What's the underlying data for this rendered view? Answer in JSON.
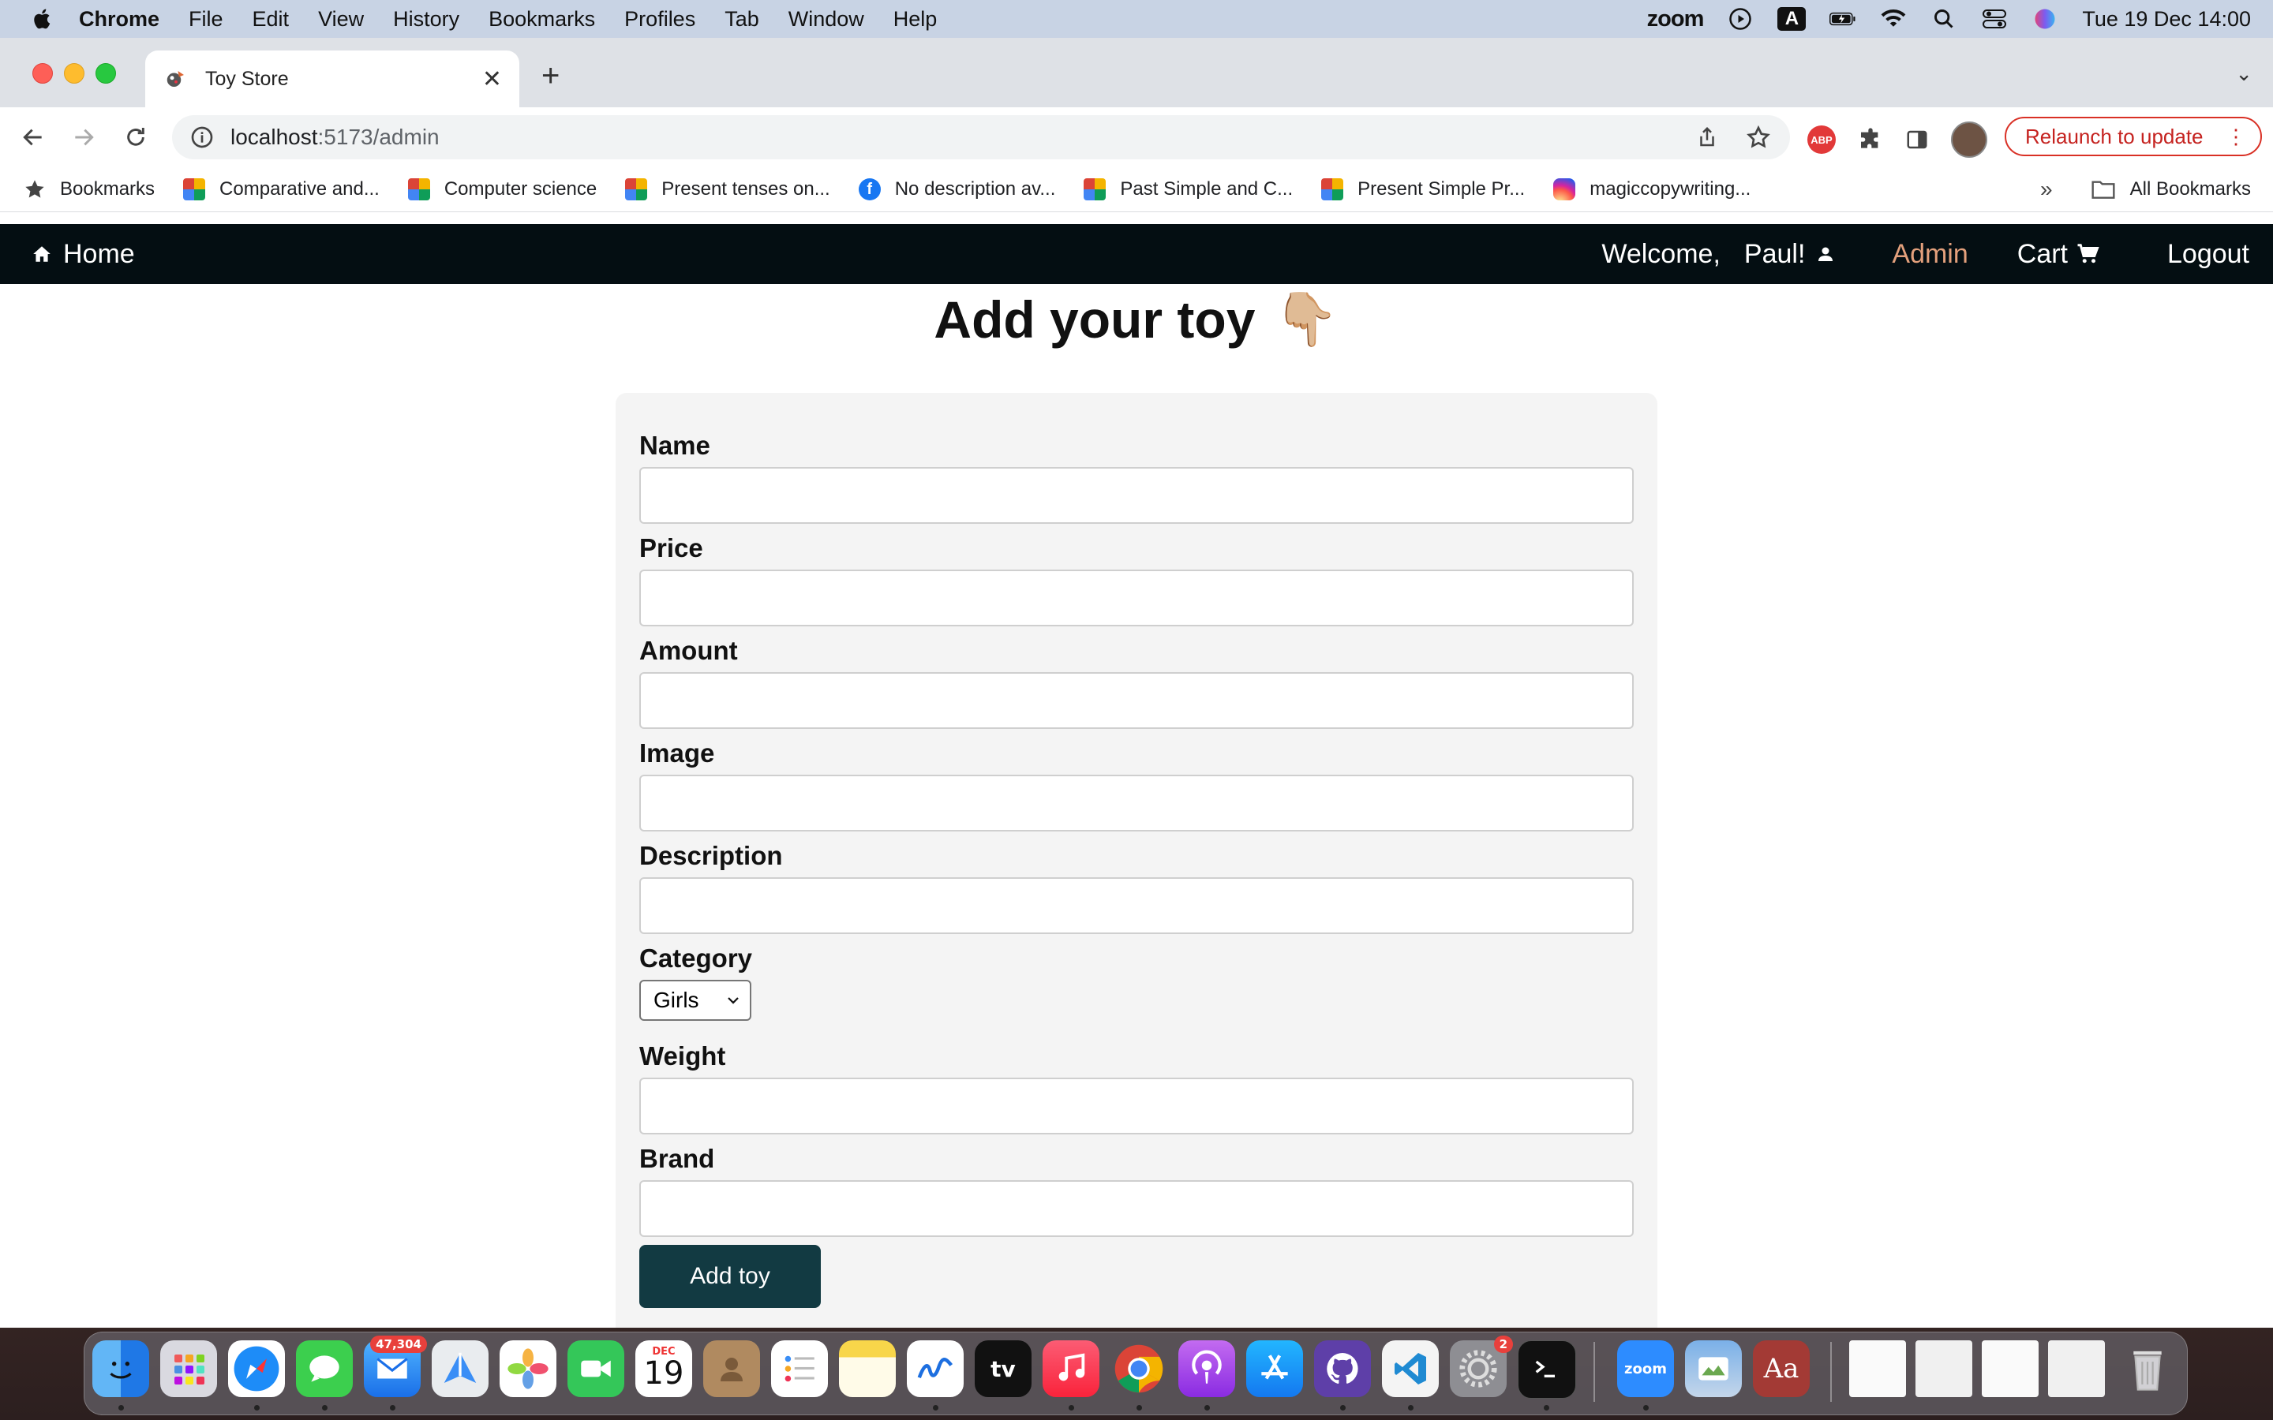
{
  "menubar": {
    "app": "Chrome",
    "items": [
      "File",
      "Edit",
      "View",
      "History",
      "Bookmarks",
      "Profiles",
      "Tab",
      "Window",
      "Help"
    ],
    "zoom": "zoom",
    "input_source": "A",
    "datetime": "Tue 19 Dec  14:00"
  },
  "browser": {
    "tab_title": "Toy Store",
    "url_host": "localhost",
    "url_path": ":5173/admin",
    "relaunch_label": "Relaunch to update",
    "abp_label": "ABP",
    "bookmarks": [
      {
        "label": "Bookmarks",
        "icon": "star-icon"
      },
      {
        "label": "Comparative and...",
        "icon": "edu-icon"
      },
      {
        "label": "Computer science",
        "icon": "edu-icon"
      },
      {
        "label": "Present tenses on...",
        "icon": "edu-icon"
      },
      {
        "label": "No description av...",
        "icon": "facebook-icon"
      },
      {
        "label": "Past Simple and C...",
        "icon": "edu-icon"
      },
      {
        "label": "Present Simple Pr...",
        "icon": "edu-icon"
      },
      {
        "label": "magiccopywriting...",
        "icon": "instagram-icon"
      }
    ],
    "more_bookmarks": "»",
    "all_bookmarks": "All Bookmarks"
  },
  "site": {
    "nav": {
      "home": "Home",
      "welcome": "Welcome,",
      "user": "Paul!",
      "admin": "Admin",
      "cart": "Cart",
      "logout": "Logout"
    },
    "title": "Add your toy",
    "title_emoji": "👇🏼",
    "form": {
      "name_label": "Name",
      "price_label": "Price",
      "amount_label": "Amount",
      "image_label": "Image",
      "description_label": "Description",
      "category_label": "Category",
      "category_value": "Girls",
      "weight_label": "Weight",
      "brand_label": "Brand",
      "submit_label": "Add toy"
    },
    "colors": {
      "navbar": "#040e12",
      "admin_link": "#e3a07c",
      "button": "#123a42"
    }
  },
  "dock": {
    "mail_badge": "47,304",
    "calendar_month": "DEC",
    "calendar_day": "19",
    "settings_badge": "2",
    "tv_label": "tv",
    "zoom_label": "zoom",
    "dictionary_label": "Aa"
  }
}
